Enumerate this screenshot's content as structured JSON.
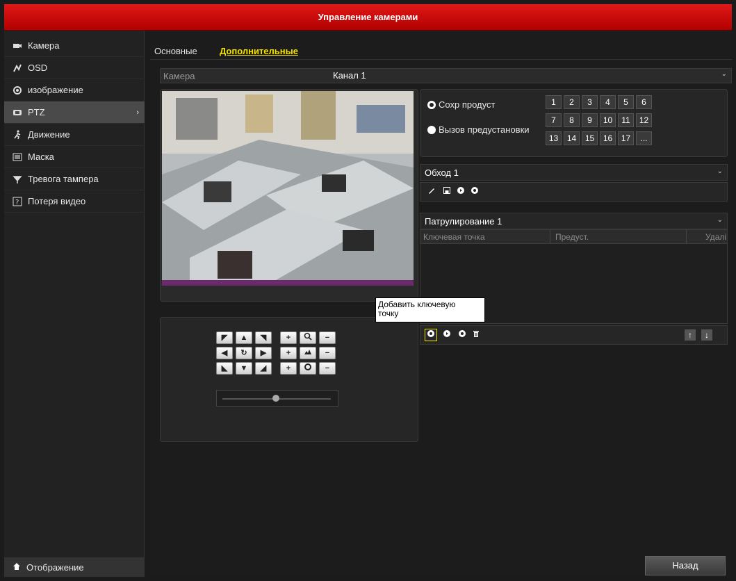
{
  "window": {
    "title": "Управление камерами"
  },
  "sidebar": {
    "items": [
      {
        "label": "Камера",
        "icon": "camera-icon"
      },
      {
        "label": "OSD",
        "icon": "osd-icon"
      },
      {
        "label": "изображение",
        "icon": "image-icon"
      },
      {
        "label": "PTZ",
        "icon": "ptz-icon",
        "active": true
      },
      {
        "label": "Движение",
        "icon": "motion-icon"
      },
      {
        "label": "Маска",
        "icon": "mask-icon"
      },
      {
        "label": "Тревога тампера",
        "icon": "tamper-icon"
      },
      {
        "label": "Потеря видео",
        "icon": "video-loss-icon"
      }
    ],
    "bottom": {
      "label": "Отображение",
      "icon": "home-icon"
    }
  },
  "tabs": [
    {
      "label": "Основные",
      "active": false
    },
    {
      "label": "Дополнительные",
      "active": true
    }
  ],
  "camera": {
    "label": "Камера",
    "value": "Канал 1"
  },
  "presets": {
    "save_label": "Сохр продуст",
    "call_label": "Вызов предустановки",
    "numbers": [
      "1",
      "2",
      "3",
      "4",
      "5",
      "6",
      "7",
      "8",
      "9",
      "10",
      "11",
      "12",
      "13",
      "14",
      "15",
      "16",
      "17",
      "..."
    ]
  },
  "patrol_route": {
    "label": "Обход 1"
  },
  "patrol": {
    "label": "Патрулирование 1",
    "columns": [
      "Ключевая точка",
      "Предуст.",
      "Удалі"
    ]
  },
  "tooltip": {
    "line1": "Добавить ключевую",
    "line2": "точку"
  },
  "ptz_buttons": {
    "zoom_plus": "+",
    "zoom_minus": "−",
    "focus_plus": "+",
    "focus_minus": "−",
    "iris_plus": "+",
    "iris_minus": "−"
  },
  "back_button": {
    "label": "Назад"
  },
  "colors": {
    "title_red": "#cc0000",
    "active_tab": "#f4e300"
  }
}
